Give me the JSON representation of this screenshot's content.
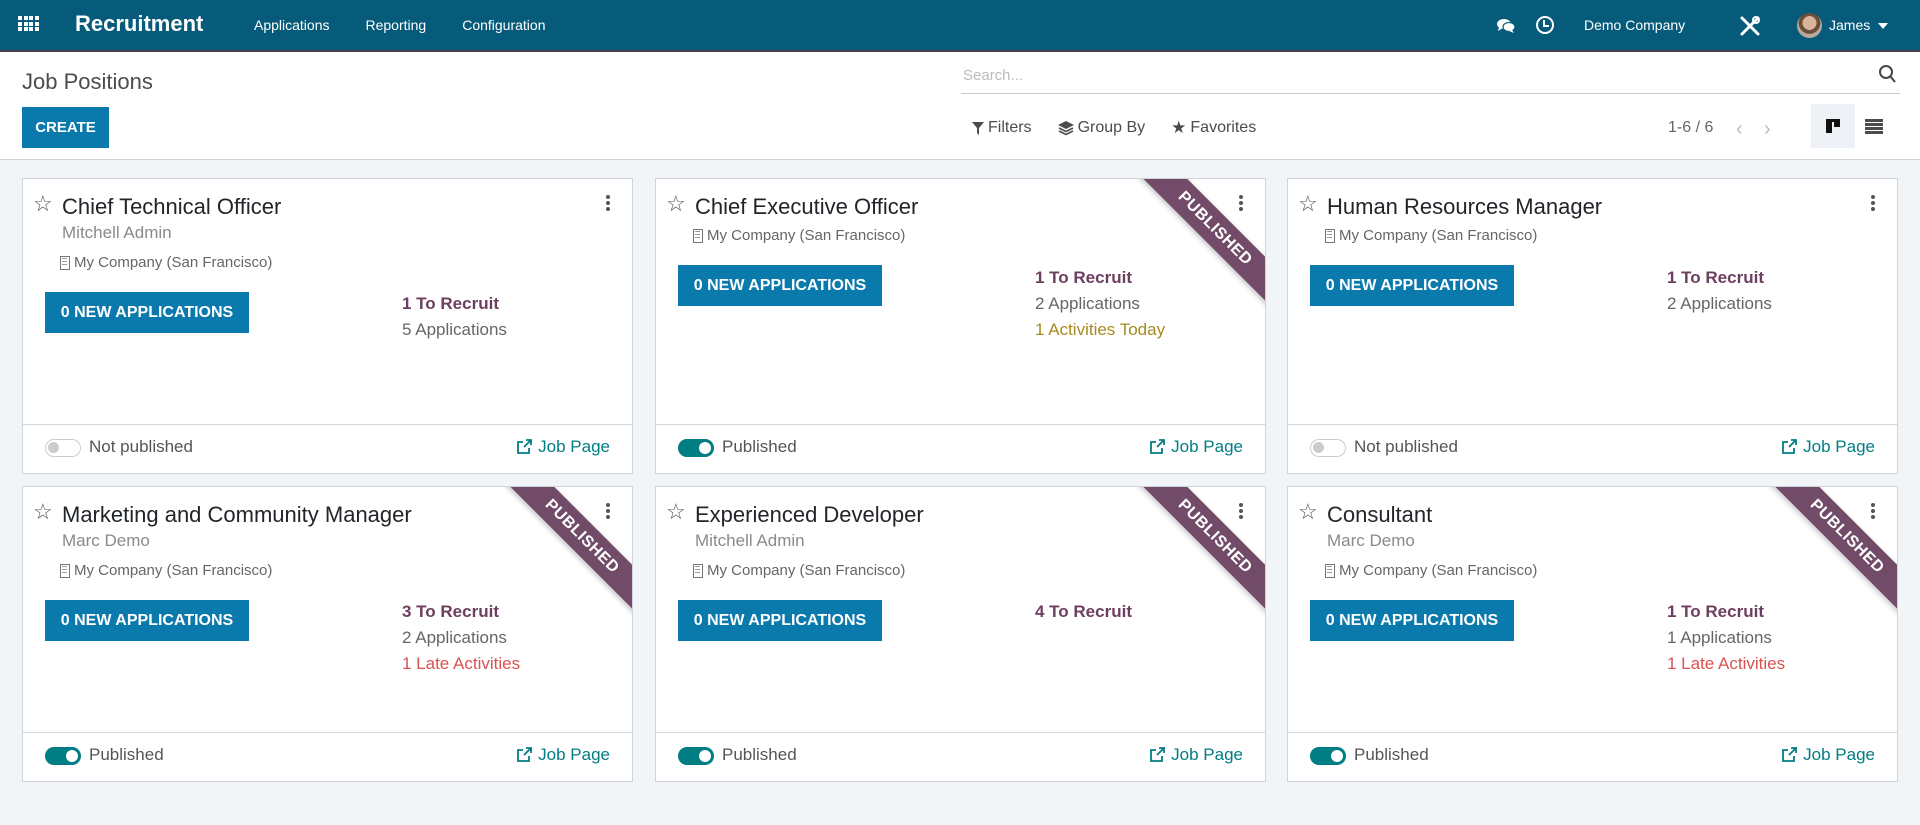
{
  "navbar": {
    "brand": "Recruitment",
    "menu": [
      "Applications",
      "Reporting",
      "Configuration"
    ],
    "company": "Demo Company",
    "user": "James",
    "icons": {
      "apps": "apps-grid-icon",
      "chat": "chat-icon",
      "activity": "clock-icon",
      "debug": "tools-icon"
    },
    "color": "#065b7b"
  },
  "control_panel": {
    "title": "Job Positions",
    "create_label": "CREATE",
    "search_placeholder": "Search...",
    "filters_label": "Filters",
    "group_by_label": "Group By",
    "favorites_label": "Favorites",
    "pager": "1-6 / 6",
    "active_view": "kanban"
  },
  "colors": {
    "primary_button": "#0a7aad",
    "to_recruit": "#6c3f5e",
    "ribbon": "#714b67",
    "toggle_on": "#017e84",
    "activity_today": "#a88a1f",
    "activity_late": "#d9534f"
  },
  "jobs": [
    {
      "title": "Chief Technical Officer",
      "recruiter": "Mitchell Admin",
      "company": "My Company (San Francisco)",
      "new_applications": "0 NEW APPLICATIONS",
      "to_recruit": "1 To Recruit",
      "applications": "5 Applications",
      "activities": "",
      "published": false,
      "published_label": "Not published",
      "ribbon": "",
      "job_page_label": "Job Page"
    },
    {
      "title": "Chief Executive Officer",
      "recruiter": "",
      "company": "My Company (San Francisco)",
      "new_applications": "0 NEW APPLICATIONS",
      "to_recruit": "1 To Recruit",
      "applications": "2 Applications",
      "activities": "1 Activities Today",
      "activities_state": "today",
      "published": true,
      "published_label": "Published",
      "ribbon": "PUBLISHED",
      "job_page_label": "Job Page"
    },
    {
      "title": "Human Resources Manager",
      "recruiter": "",
      "company": "My Company (San Francisco)",
      "new_applications": "0 NEW APPLICATIONS",
      "to_recruit": "1 To Recruit",
      "applications": "2 Applications",
      "activities": "",
      "published": false,
      "published_label": "Not published",
      "ribbon": "",
      "job_page_label": "Job Page"
    },
    {
      "title": "Marketing and Community Manager",
      "recruiter": "Marc Demo",
      "company": "My Company (San Francisco)",
      "new_applications": "0 NEW APPLICATIONS",
      "to_recruit": "3 To Recruit",
      "applications": "2 Applications",
      "activities": "1 Late Activities",
      "activities_state": "late",
      "published": true,
      "published_label": "Published",
      "ribbon": "PUBLISHED",
      "job_page_label": "Job Page"
    },
    {
      "title": "Experienced Developer",
      "recruiter": "Mitchell Admin",
      "company": "My Company (San Francisco)",
      "new_applications": "0 NEW APPLICATIONS",
      "to_recruit": "4 To Recruit",
      "applications": "",
      "activities": "",
      "published": true,
      "published_label": "Published",
      "ribbon": "PUBLISHED",
      "job_page_label": "Job Page"
    },
    {
      "title": "Consultant",
      "recruiter": "Marc Demo",
      "company": "My Company (San Francisco)",
      "new_applications": "0 NEW APPLICATIONS",
      "to_recruit": "1 To Recruit",
      "applications": "1 Applications",
      "activities": "1 Late Activities",
      "activities_state": "late",
      "published": true,
      "published_label": "Published",
      "ribbon": "PUBLISHED",
      "job_page_label": "Job Page"
    }
  ]
}
